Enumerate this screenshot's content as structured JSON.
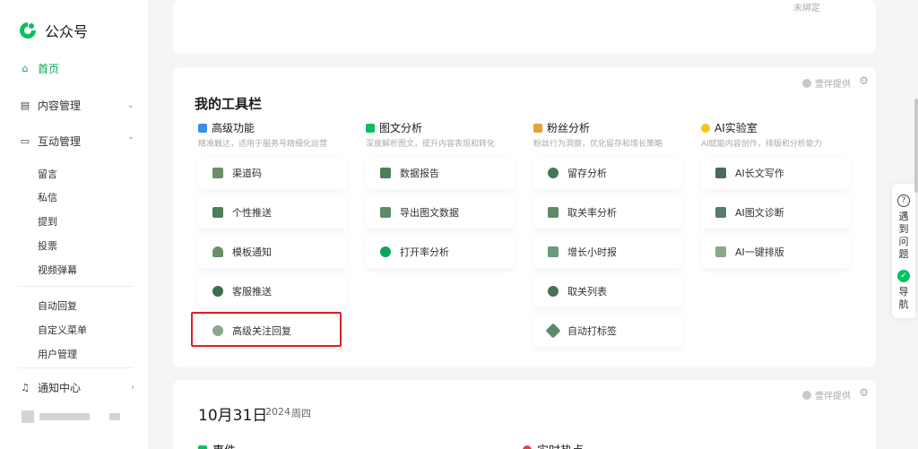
{
  "sidebar": {
    "logo_text": "公众号",
    "items": {
      "home": "首页",
      "content": "内容管理",
      "interaction": "互动管理",
      "notice": "通知中心"
    },
    "sub_items": [
      "留言",
      "私信",
      "提到",
      "投票",
      "视频弹幕",
      "自动回复",
      "自定义菜单",
      "用户管理"
    ]
  },
  "top_panel": {
    "status": "未绑定"
  },
  "toolbar": {
    "provider": "壹伴提供",
    "title": "我的工具栏",
    "columns": [
      {
        "title": "高级功能",
        "desc": "精准触达，适用于服务号精细化运营",
        "color": "#3a8ee6",
        "tools": [
          "渠道码",
          "个性推送",
          "模板通知",
          "客服推送",
          "高级关注回复"
        ]
      },
      {
        "title": "图文分析",
        "desc": "深度解析图文，提升内容表现和转化",
        "color": "#07c160",
        "tools": [
          "数据报告",
          "导出图文数据",
          "打开率分析"
        ]
      },
      {
        "title": "粉丝分析",
        "desc": "粉丝行为洞察，优化留存和增长策略",
        "color": "#e6a23c",
        "tools": [
          "留存分析",
          "取关率分析",
          "增长小时报",
          "取关列表",
          "自动打标签"
        ]
      },
      {
        "title": "AI实验室",
        "desc": "AI赋能内容创作，排版和分析能力",
        "color": "#f5c518",
        "tools": [
          "AI长文写作",
          "AI图文诊断",
          "AI一键排版"
        ]
      }
    ]
  },
  "date_panel": {
    "provider": "壹伴提供",
    "date": "10月31日",
    "year": "2024",
    "weekday": "周四",
    "events_label": "事件",
    "hot_label": "实时热点"
  },
  "float_bar": {
    "help": "遇到问题",
    "nav": "导航"
  }
}
